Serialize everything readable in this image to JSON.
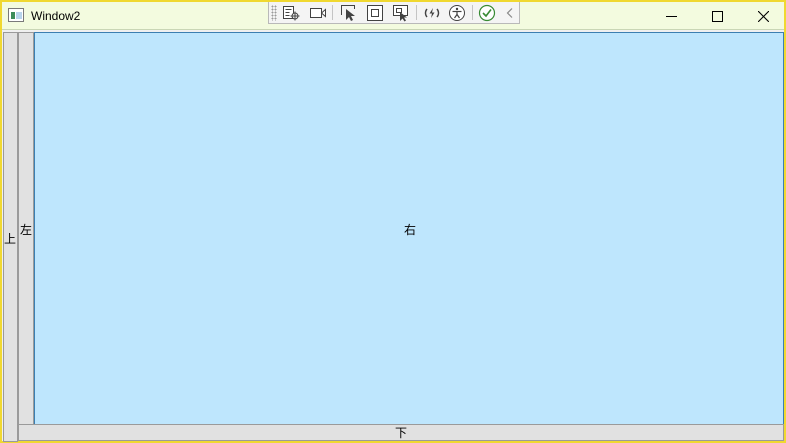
{
  "window": {
    "title": "Window2",
    "border_color": "#f0d830",
    "titlebar_color": "#f3fbdf"
  },
  "title_controls": {
    "minimize_icon": "minimize-icon",
    "maximize_icon": "maximize-icon",
    "close_icon": "close-icon"
  },
  "debug_toolbar": {
    "buttons": [
      "live-visual-tree-icon",
      "record-icon",
      "select-element-icon",
      "display-layout-adorner-icon",
      "track-focused-element-icon",
      "hot-reload-icon",
      "accessibility-icon",
      "binding-checked-icon",
      "collapse-chevron-icon"
    ]
  },
  "panes": {
    "top": {
      "label": "上",
      "color": "#e1e1e1"
    },
    "left": {
      "label": "左",
      "color": "#e1e1e1"
    },
    "right": {
      "label": "右",
      "color": "#bee6fd"
    },
    "bottom": {
      "label": "下",
      "color": "#e1e1e1"
    }
  }
}
